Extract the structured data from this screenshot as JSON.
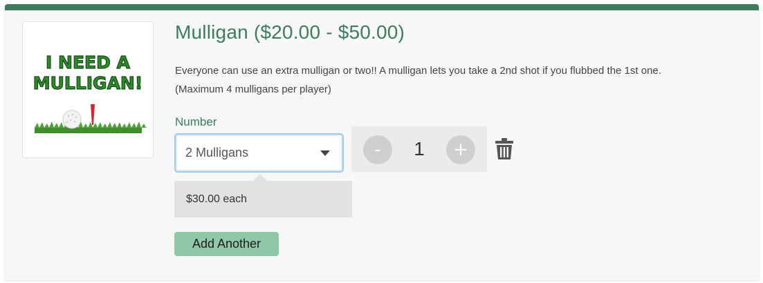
{
  "product": {
    "title": "Mulligan ($20.00 - $50.00)",
    "description_line1": "Everyone can use an extra mulligan or two!!  A mulligan lets you take a 2nd shot if you flubbed the 1st one.",
    "description_line2": "(Maximum 4 mulligans per player)",
    "image": {
      "text_line1": "I NEED A",
      "text_line2": "MULLIGAN!",
      "icon": "golf-ball-on-tee"
    }
  },
  "option": {
    "label": "Number",
    "selected_value": "2 Mulligans",
    "price_note": "$30.00 each"
  },
  "quantity": {
    "minus_label": "-",
    "value": "1",
    "plus_label": "+"
  },
  "actions": {
    "delete_icon": "trash-icon",
    "add_another_label": "Add Another"
  },
  "colors": {
    "accent": "#3c7d5f",
    "header_bar": "#3f7a5c",
    "add_button": "#8fc7a8",
    "focus_border": "#9fcbe6"
  }
}
